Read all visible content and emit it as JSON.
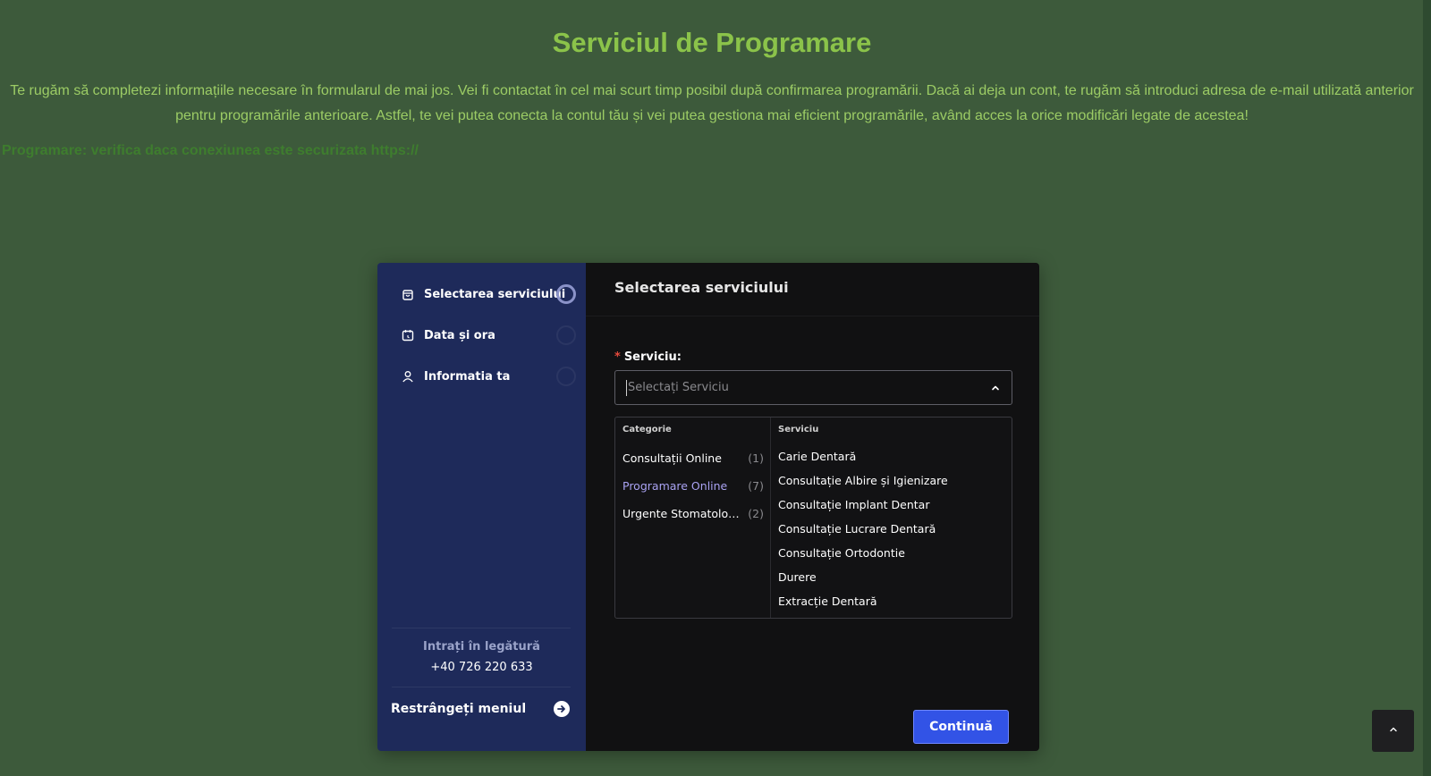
{
  "page": {
    "title": "Serviciul de Programare",
    "intro": "Te rugăm să completezi informațiile necesare în formularul de mai jos. Vei fi contactat în cel mai scurt timp posibil după confirmarea programării. Dacă ai deja un cont, te rugăm să introduci adresa de e-mail utilizată anterior pentru programările anterioare. Astfel, te vei putea conecta la contul tău și vei putea gestiona mai eficient programările, având acces la orice modificări legate de acestea!",
    "secure_note": "Programare: verifica daca conexiunea este securizata https://"
  },
  "sidebar": {
    "steps": [
      {
        "label": "Selectarea serviciului",
        "icon": "bag-icon",
        "active": true
      },
      {
        "label": "Data și ora",
        "icon": "calendar-icon",
        "active": false
      },
      {
        "label": "Informatia ta",
        "icon": "user-icon",
        "active": false
      }
    ],
    "contact_label": "Intrați în legătură",
    "contact_phone": "+40 726 220 633",
    "collapse_label": "Restrângeți meniul"
  },
  "main": {
    "header": "Selectarea serviciului",
    "field_label": "Serviciu:",
    "required_mark": "*",
    "select_placeholder": "Selectați Serviciu",
    "dropdown": {
      "category_header": "Categorie",
      "service_header": "Serviciu",
      "categories": [
        {
          "name": "Consultații Online",
          "count": "(1)",
          "selected": false
        },
        {
          "name": "Programare Online",
          "count": "(7)",
          "selected": true
        },
        {
          "name": "Urgente Stomatologice",
          "count": "(2)",
          "selected": false
        }
      ],
      "services": [
        "Carie Dentară",
        "Consultație Albire și Igienizare",
        "Consultație Implant Dentar",
        "Consultație Lucrare Dentară",
        "Consultație Ortodontie",
        "Durere",
        "Extracție Dentară"
      ]
    },
    "continue_label": "Continuă"
  },
  "colors": {
    "background": "#3d5a3b",
    "title": "#8bc34a",
    "sidebar": "#1e2a5a",
    "panel": "#111112",
    "accent": "#3253e6",
    "selected_category": "#a9a2f2"
  }
}
